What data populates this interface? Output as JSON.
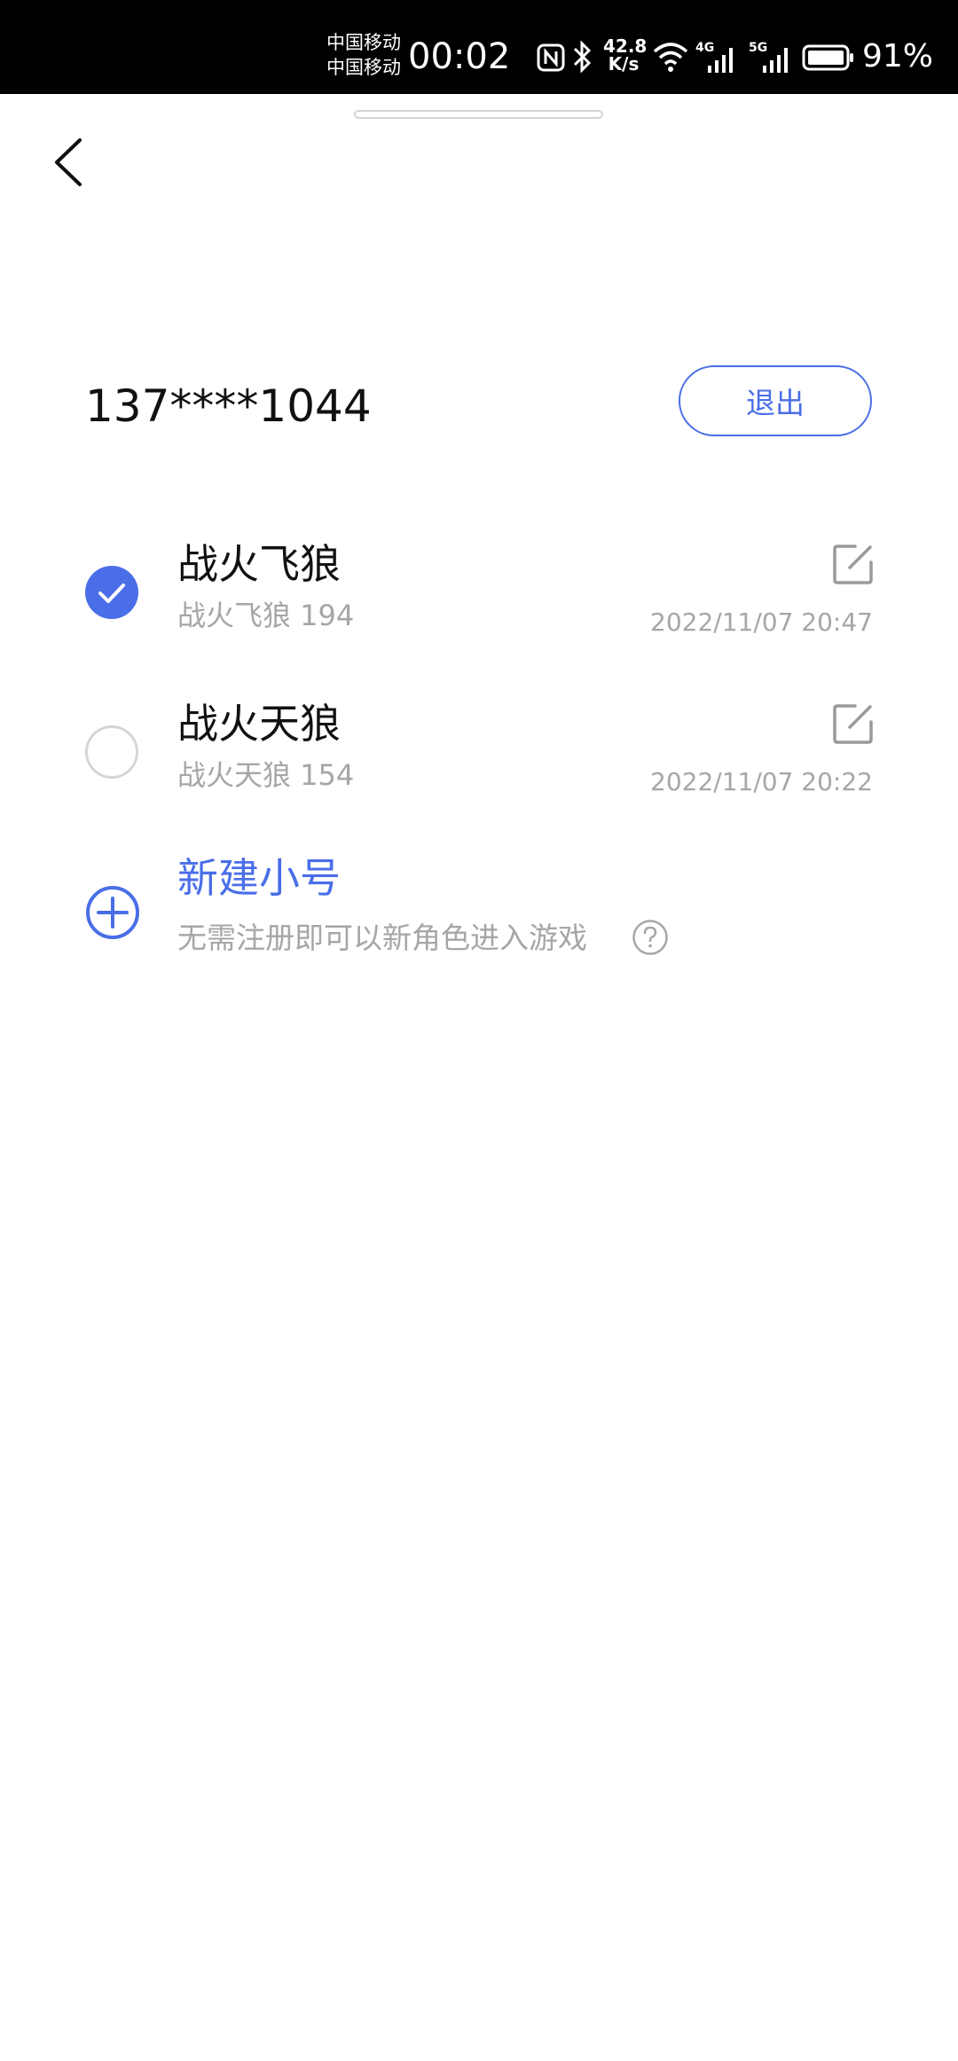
{
  "status_bar": {
    "carrier_1": "中国移动",
    "carrier_2": "中国移动",
    "time": "00:02",
    "net_speed_value": "42.8",
    "net_speed_unit": "K/s",
    "sim1_network": "4G",
    "sim2_network": "5G",
    "battery_percent": "91%",
    "icons": [
      "nfc-icon",
      "bluetooth-icon",
      "wifi-icon",
      "signal-icon",
      "battery-icon"
    ]
  },
  "header": {
    "back_icon": "chevron-left-icon"
  },
  "account": {
    "phone": "137****1044",
    "logout_label": "退出"
  },
  "roles": [
    {
      "name": "战火飞狼",
      "subtitle": "战火飞狼 194",
      "timestamp": "2022/11/07 20:47",
      "selected": true
    },
    {
      "name": "战火天狼",
      "subtitle": "战火天狼 154",
      "timestamp": "2022/11/07 20:22",
      "selected": false
    }
  ],
  "new_account": {
    "title": "新建小号",
    "description": "无需注册即可以新角色进入游戏"
  },
  "colors": {
    "accent": "#4a6ee8",
    "secondary_text": "#a6a6a6",
    "primary_text": "#111111",
    "status_bar_bg": "#000000"
  }
}
